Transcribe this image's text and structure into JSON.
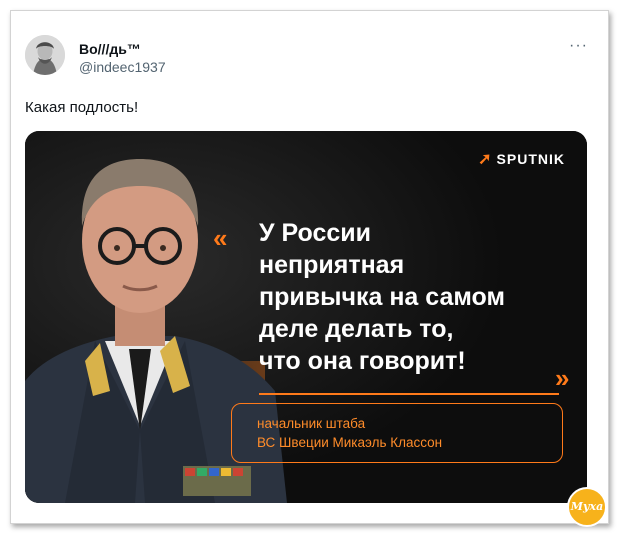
{
  "tweet": {
    "display_name": "Bo///дь™",
    "handle": "@indeec1937",
    "more_label": "···",
    "text": "Какая подлость!"
  },
  "media": {
    "brand": "SPUTNIK",
    "quote_open": "«",
    "quote_close": "»",
    "quote_lines": [
      "У России",
      "неприятная",
      "привычка на самом",
      "деле делать то,",
      "что она говорит!"
    ],
    "attribution_lines": [
      "начальник штаба",
      "ВС Швеции Микаэль Классон"
    ],
    "colors": {
      "accent": "#ff7a1a",
      "background": "#0d0d0d"
    }
  },
  "watermark": {
    "text": "Муха"
  }
}
